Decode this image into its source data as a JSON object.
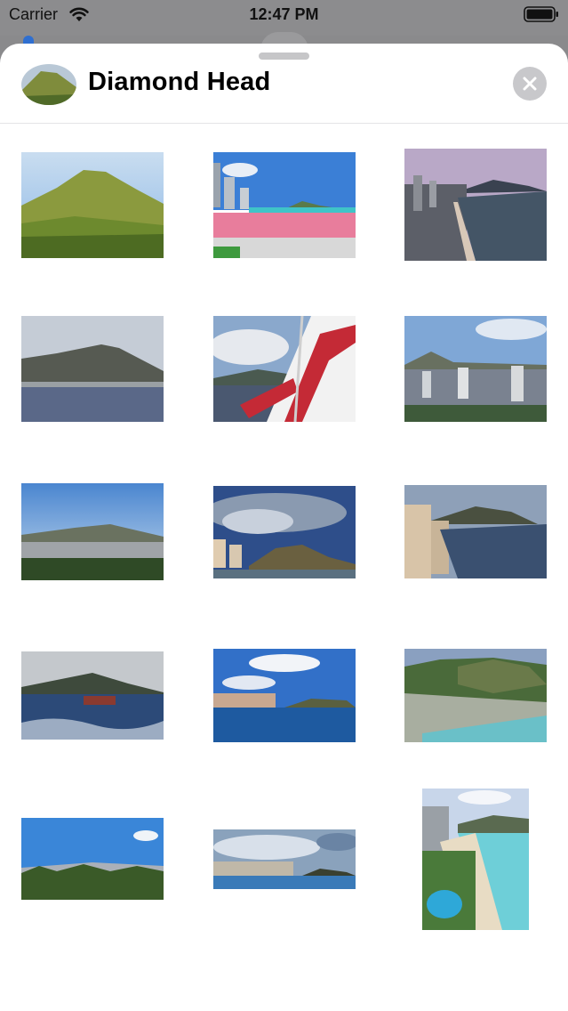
{
  "status_bar": {
    "carrier": "Carrier",
    "time": "12:47 PM",
    "icons": [
      "wifi-icon",
      "battery-icon"
    ]
  },
  "sheet": {
    "title": "Diamond Head",
    "close_icon": "close-icon",
    "photos": [
      "mountain-grassland",
      "waikiki-beach-promenade",
      "city-shoreline-dusk",
      "crater-from-sea",
      "american-flag-crater",
      "city-skyline-crater",
      "city-valley-panorama",
      "hotels-stormy-sky",
      "hotel-coast-bay",
      "boat-ocean-waves",
      "skyline-across-water",
      "aerial-crater-neighborhood",
      "palms-ocean-view",
      "distant-skyline-cloudy",
      "resort-pool-aerial"
    ]
  },
  "colors": {
    "sheet_background": "#ffffff",
    "dimmed_background": "#8a8a8c",
    "close_button": "#c8c8cb"
  }
}
